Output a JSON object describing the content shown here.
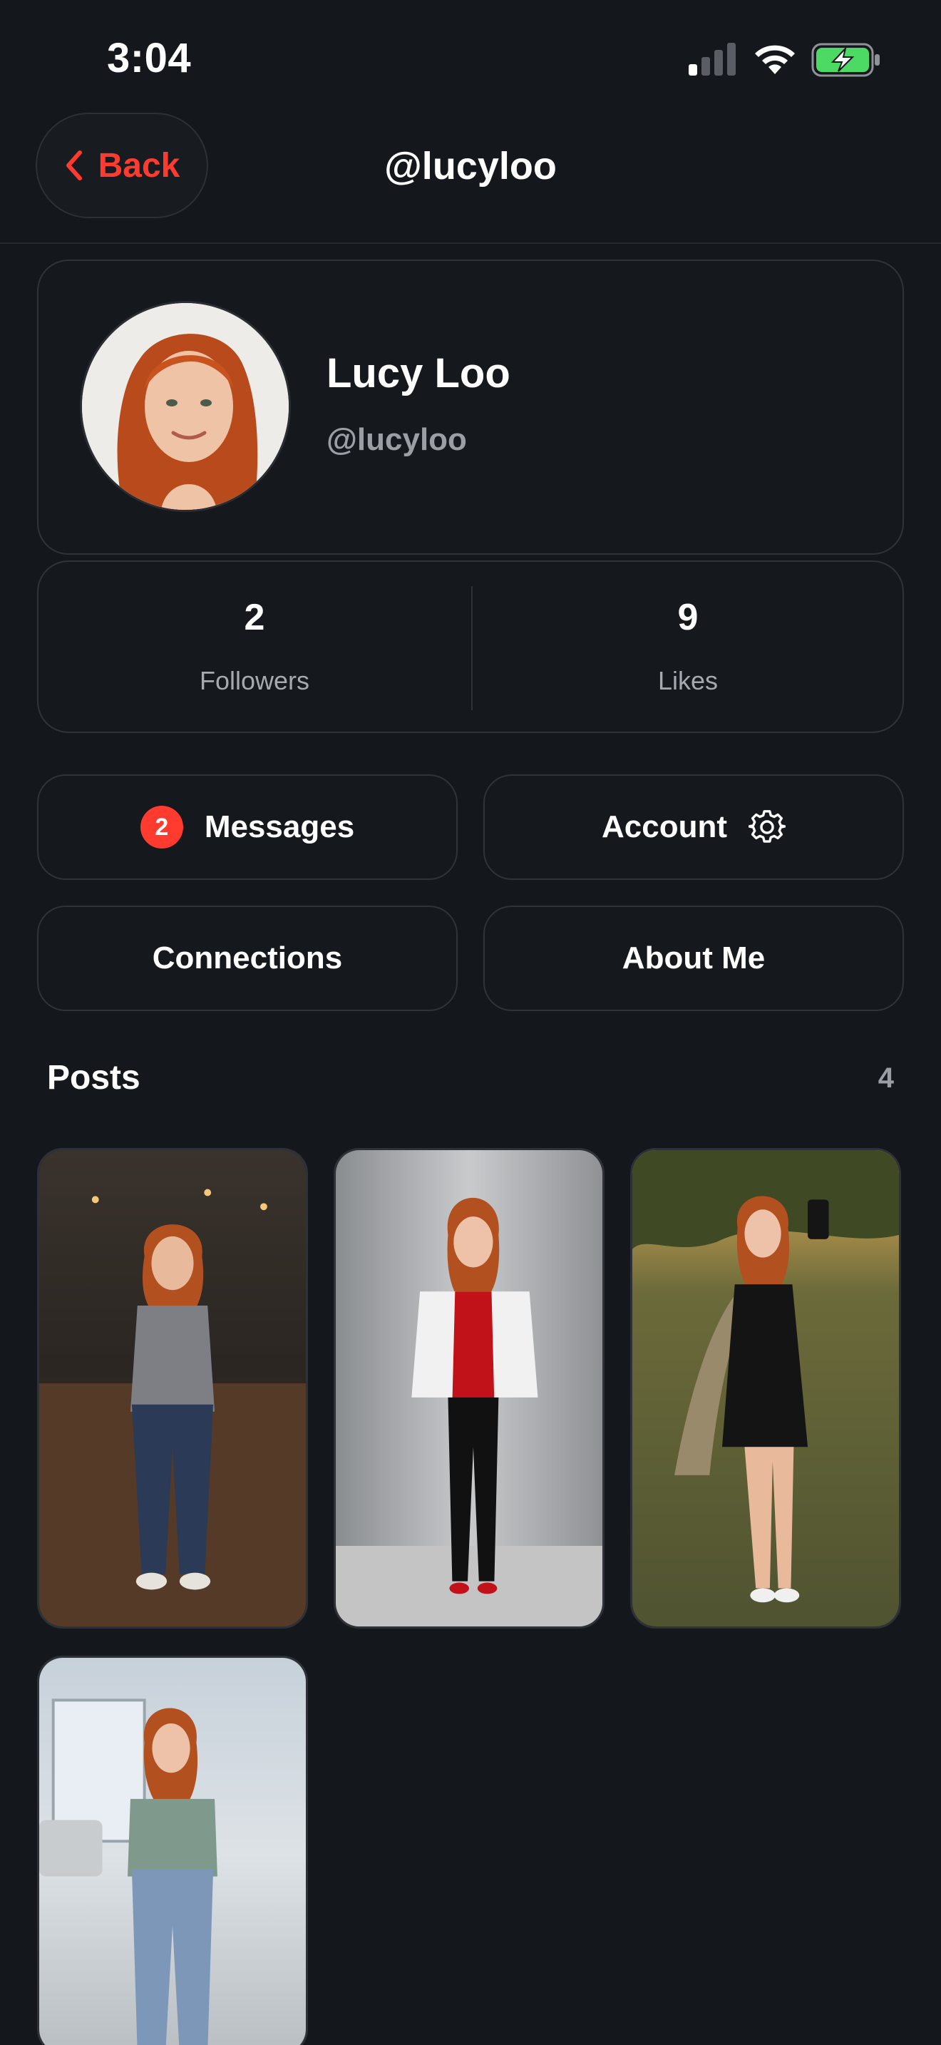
{
  "status_bar": {
    "time": "3:04",
    "icons": [
      "cellular-signal-icon",
      "wifi-icon",
      "battery-charging-icon"
    ],
    "battery_color": "#4cd964"
  },
  "nav": {
    "back_label": "Back",
    "title": "@lucyloo",
    "accent_color": "#ff3b30"
  },
  "profile": {
    "name": "Lucy Loo",
    "handle": "@lucyloo"
  },
  "stats": {
    "followers": {
      "value": "2",
      "label": "Followers"
    },
    "likes": {
      "value": "9",
      "label": "Likes"
    }
  },
  "actions": {
    "messages": {
      "label": "Messages",
      "badge": "2"
    },
    "account": {
      "label": "Account",
      "icon": "gear-icon"
    },
    "connections": {
      "label": "Connections"
    },
    "about": {
      "label": "About Me"
    }
  },
  "posts": {
    "title": "Posts",
    "count": "4",
    "items": [
      {
        "scene": "office-loft-gray-tshirt-jeans"
      },
      {
        "scene": "elevator-white-jacket-red-shirt"
      },
      {
        "scene": "park-sunset-black-dress-selfie"
      },
      {
        "scene": "living-room-green-tshirt-jeans"
      }
    ]
  }
}
